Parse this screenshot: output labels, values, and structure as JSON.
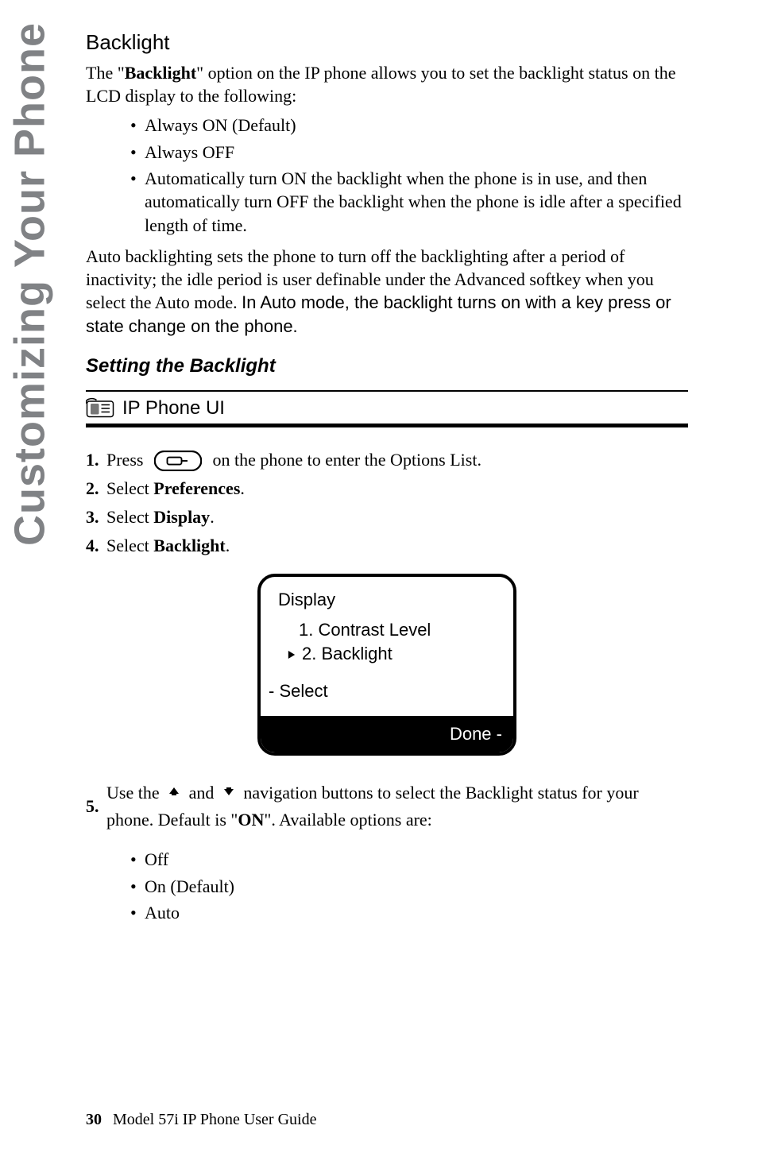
{
  "sidebar": {
    "tab_label": "Customizing Your Phone"
  },
  "section": {
    "title": "Backlight",
    "intro_open": "The \"",
    "intro_bold": "Backlight",
    "intro_rest": "\" option on the IP phone allows you to set the backlight status on the LCD display to the following:",
    "bullets1": [
      "Always ON (Default)",
      "Always OFF",
      "Automatically turn ON the backlight when the phone is in use, and then automatically turn OFF the backlight when the phone is idle after a specified length of time."
    ],
    "para2_a": "Auto backlighting sets the phone to turn off the backlighting after a period of inactivity; the idle period is user definable under the Advanced softkey when you select the Auto mode. ",
    "para2_b": "In Auto mode, the backlight turns on with a key press or state change on the phone."
  },
  "setting": {
    "heading": "Setting the Backlight",
    "ui_box_title": "IP Phone UI",
    "steps": {
      "s1_a": "Press",
      "s1_b": "on the phone to enter the Options List.",
      "s2_a": "Select ",
      "s2_bold": "Preferences",
      "s2_b": ".",
      "s3_a": "Select ",
      "s3_bold": "Display",
      "s3_b": ".",
      "s4_a": "Select ",
      "s4_bold": "Backlight",
      "s4_b": "."
    }
  },
  "lcd": {
    "title": "Display",
    "opt1": "1. Contrast Level",
    "opt2": "2. Backlight",
    "select": "- Select",
    "done": "Done -"
  },
  "step5": {
    "pre": "Use the",
    "mid": "and",
    "tail_a": "navigation  buttons to select the Backlight status for your phone. Default is \"",
    "tail_bold": "ON",
    "tail_b": "\". Available options are:",
    "bullets": [
      "Off",
      "On (Default)",
      "Auto"
    ]
  },
  "footer": {
    "page_num": "30",
    "doc_title": "Model 57i IP Phone User Guide"
  }
}
